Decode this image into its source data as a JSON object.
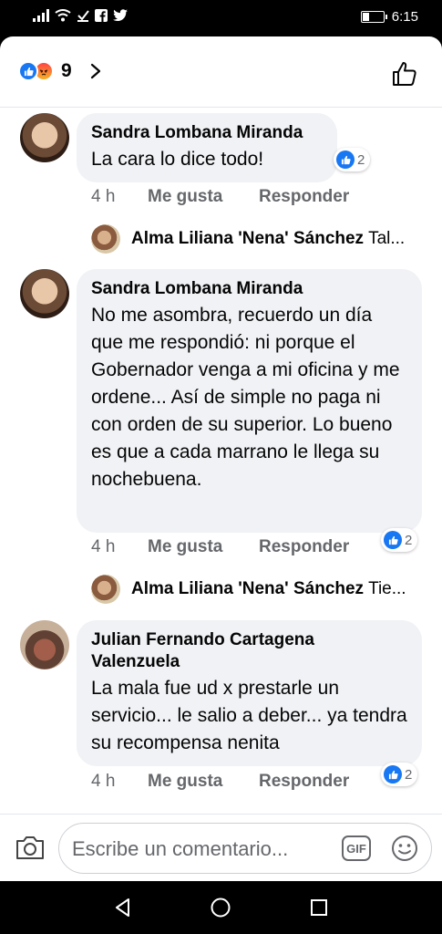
{
  "status_bar": {
    "time": "6:15",
    "icons": [
      "signal-icon",
      "wifi-icon",
      "download-icon",
      "facebook-icon",
      "twitter-icon",
      "battery-icon"
    ]
  },
  "reactions": {
    "count": "9",
    "types": [
      "like",
      "angry"
    ]
  },
  "comments": [
    {
      "author": "Sandra Lombana Miranda",
      "text": "La cara lo dice todo!",
      "likes": "2",
      "time": "4 h",
      "like_label": "Me gusta",
      "reply_label": "Responder",
      "reply": {
        "author": "Alma Liliana 'Nena' Sánchez",
        "text": "Tal..."
      }
    },
    {
      "author": "Sandra Lombana Miranda",
      "text": "No me asombra, recuerdo un día que me respondió: ni porque el Gobernador venga a mi oficina y me ordene... Así de simple no paga ni con orden de su superior. Lo bueno es que a cada marrano le llega su nochebuena.",
      "likes": "2",
      "time": "4 h",
      "like_label": "Me gusta",
      "reply_label": "Responder",
      "reply": {
        "author": "Alma Liliana 'Nena' Sánchez",
        "text": "Tie..."
      }
    },
    {
      "author": "Julian Fernando Cartagena Valenzuela",
      "text": "La mala fue ud x prestarle un servicio... le salio a deber... ya tendra su recompensa nenita",
      "likes": "2",
      "time": "4 h",
      "like_label": "Me gusta",
      "reply_label": "Responder"
    }
  ],
  "composer": {
    "placeholder": "Escribe un comentario...",
    "gif_label": "GIF"
  },
  "colors": {
    "accent": "#1877f2",
    "bubble": "#f0f2f5",
    "secondary_text": "#65676b"
  }
}
